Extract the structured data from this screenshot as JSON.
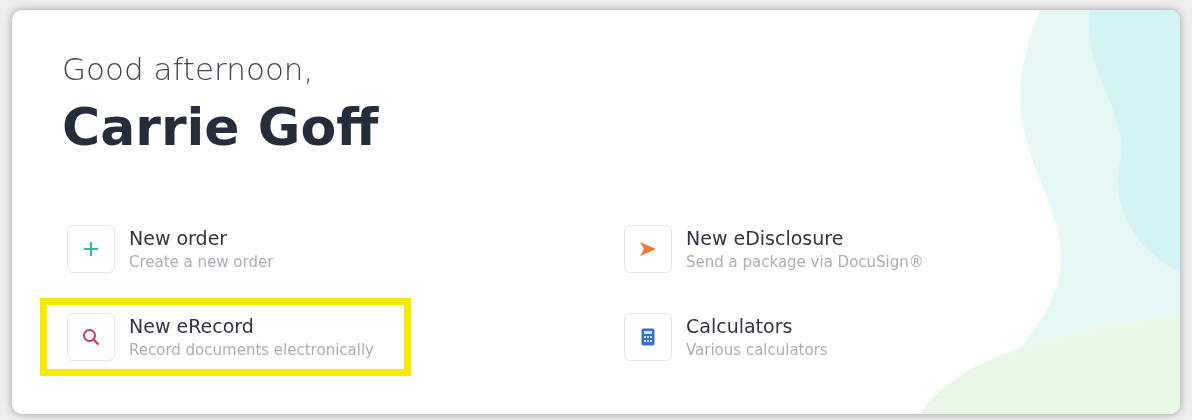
{
  "greeting": "Good afternoon,",
  "name": "Carrie Goff",
  "actions": [
    {
      "kind": "plus",
      "title": "New order",
      "subtitle": "Create a new order",
      "highlighted": false
    },
    {
      "kind": "send",
      "title": "New eDisclosure",
      "subtitle": "Send a package via DocuSign®",
      "highlighted": false
    },
    {
      "kind": "search",
      "title": "New eRecord",
      "subtitle": "Record documents electronically",
      "highlighted": true
    },
    {
      "kind": "calculator",
      "title": "Calculators",
      "subtitle": "Various calculators",
      "highlighted": false
    }
  ]
}
